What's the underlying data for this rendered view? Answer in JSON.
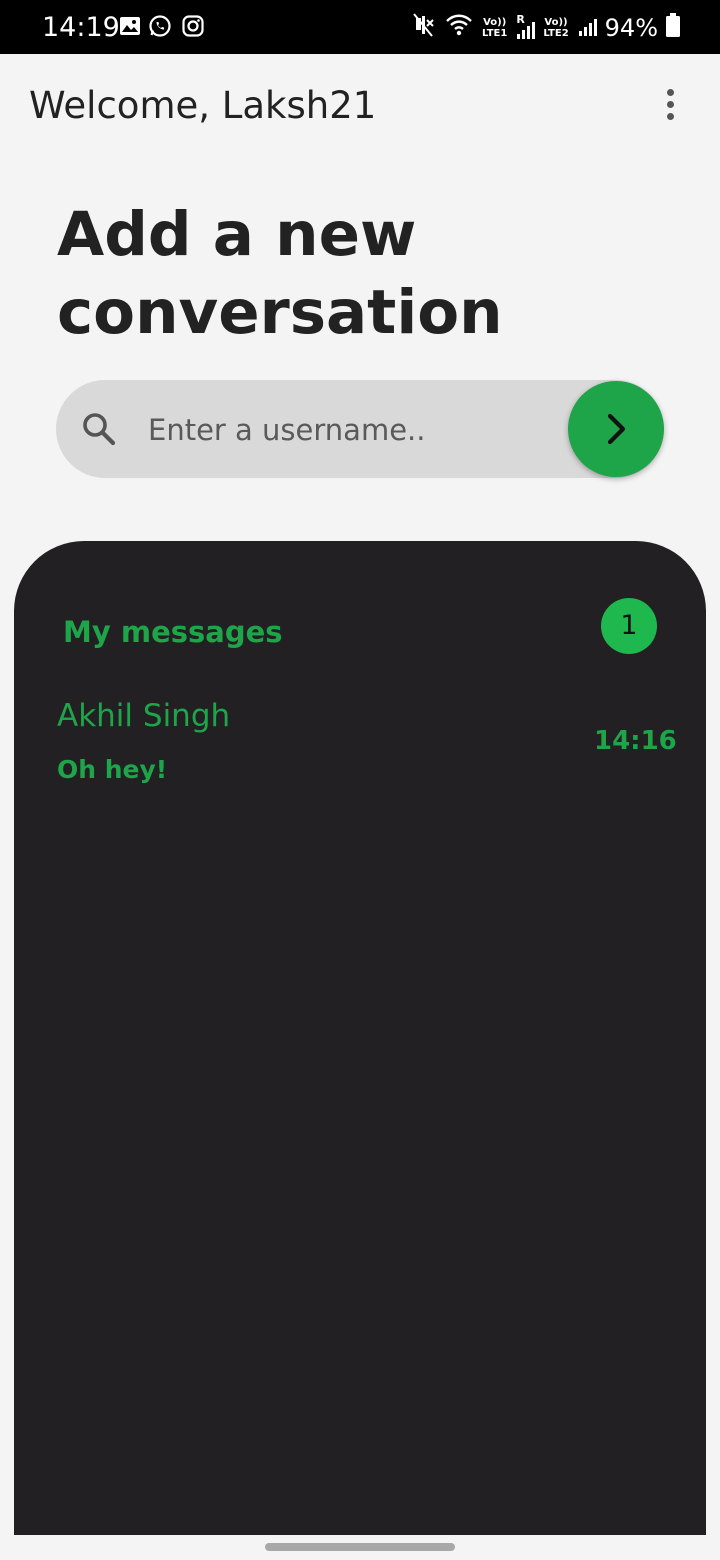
{
  "status_bar": {
    "time": "14:19",
    "left_icons": [
      "gallery-icon",
      "whatsapp-icon",
      "instagram-icon"
    ],
    "network": {
      "sim1_volte": "Vo))",
      "sim1_lte": "LTE1",
      "roaming": "R",
      "sim2_volte": "Vo))",
      "sim2_lte": "LTE2"
    },
    "battery": "94%"
  },
  "header": {
    "title": "Welcome, Laksh21",
    "menu_icon": "more-vert-icon"
  },
  "new_conversation": {
    "heading": "Add a new conversation",
    "search": {
      "placeholder": "Enter a username..",
      "value": "",
      "icon": "search-icon"
    },
    "go_icon": "chevron-right-icon"
  },
  "messages": {
    "title": "My messages",
    "count": "1",
    "conversations": [
      {
        "name": "Akhil Singh",
        "preview": "Oh hey!",
        "time": "14:16"
      }
    ]
  },
  "colors": {
    "accent": "#1ea54a",
    "panel_bg": "#232023",
    "page_bg": "#f4f4f4",
    "search_bg": "#d9d9d9"
  }
}
